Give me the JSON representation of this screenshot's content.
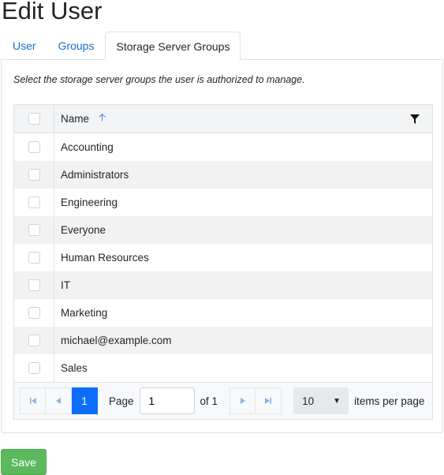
{
  "page": {
    "title": "Edit User"
  },
  "tabs": [
    {
      "label": "User",
      "active": false
    },
    {
      "label": "Groups",
      "active": false
    },
    {
      "label": "Storage Server Groups",
      "active": true
    }
  ],
  "panel": {
    "hint": "Select the storage server groups the user is authorized to manage."
  },
  "grid": {
    "column_name": "Name",
    "sort_icon": "arrow-up-icon",
    "filter_icon": "filter-icon",
    "rows": [
      {
        "name": "Accounting",
        "checked": false
      },
      {
        "name": "Administrators",
        "checked": false
      },
      {
        "name": "Engineering",
        "checked": false
      },
      {
        "name": "Everyone",
        "checked": false
      },
      {
        "name": "Human Resources",
        "checked": false
      },
      {
        "name": "IT",
        "checked": false
      },
      {
        "name": "Marketing",
        "checked": false
      },
      {
        "name": "michael@example.com",
        "checked": false
      },
      {
        "name": "Sales",
        "checked": false
      }
    ]
  },
  "pager": {
    "current_page": "1",
    "page_label": "Page",
    "page_input_value": "1",
    "of_label": "of 1",
    "page_size": "10",
    "items_per_page_label": "items per page",
    "colors": {
      "current": "#0d6efd",
      "arrows": "#8fb3e0"
    }
  },
  "actions": {
    "save_label": "Save",
    "save_color": "#5cb85c"
  }
}
